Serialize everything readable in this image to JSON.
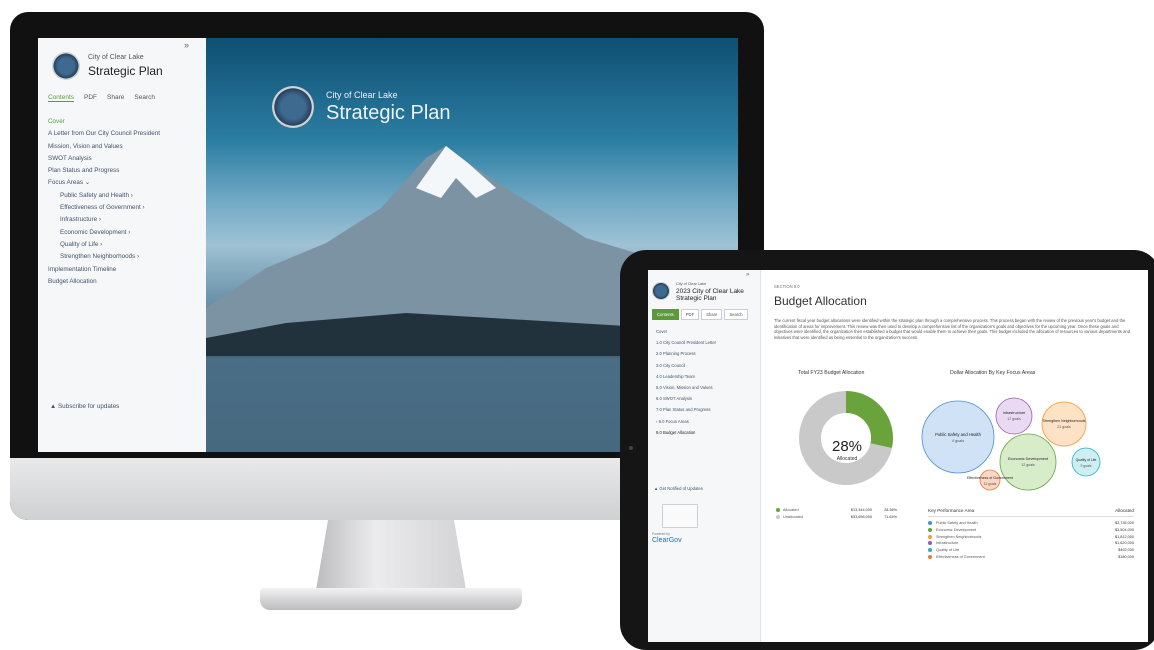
{
  "monitor": {
    "sidebar": {
      "city": "City of Clear Lake",
      "title": "Strategic Plan",
      "collapse_icon": "double-chevron-right-icon",
      "tabs": [
        "Contents",
        "PDF",
        "Share",
        "Search"
      ],
      "nav": [
        {
          "label": "Cover",
          "current": true
        },
        {
          "label": "A Letter from Our City Council President"
        },
        {
          "label": "Mission, Vision and Values"
        },
        {
          "label": "SWOT Analysis"
        },
        {
          "label": "Plan Status and Progress"
        },
        {
          "label": "Focus Areas"
        },
        {
          "label": "Public Safety and Health",
          "sub": true
        },
        {
          "label": "Effectiveness of Government",
          "sub": true
        },
        {
          "label": "Infrastructure",
          "sub": true
        },
        {
          "label": "Economic Development",
          "sub": true
        },
        {
          "label": "Quality of Life",
          "sub": true
        },
        {
          "label": "Strengthen Neighborhoods",
          "sub": true
        },
        {
          "label": "Implementation Timeline"
        },
        {
          "label": "Budget Allocation"
        }
      ],
      "subscribe": "Subscribe for updates"
    },
    "hero": {
      "city": "City of Clear Lake",
      "title": "Strategic Plan"
    }
  },
  "tablet": {
    "sidebar": {
      "city": "City of Clear Lake",
      "title": "2023 City of Clear Lake Strategic Plan",
      "tabs": [
        "Contents",
        "PDF",
        "Share",
        "Search"
      ],
      "nav": [
        "Cover",
        "1.0 City Council President Letter",
        "2.0 Planning Process",
        "3.0 City Council",
        "4.0 Leadership Team",
        "5.0 Vision, Mission and Values",
        "6.0 SWOT Analysis",
        "7.0 Plan Status and Progress",
        "8.0 Focus Areas",
        "9.0 Budget Allocation"
      ],
      "notify": "Get Notified of Updates",
      "powered_by": "Powered by",
      "brand": "ClearGov"
    },
    "main": {
      "section": "SECTION 9.0",
      "title": "Budget Allocation",
      "paragraph": "The current fiscal year budget allocations were identified within the strategic plan through a comprehensive process. This process began with the review of the previous year's budget and the identification of areas for improvement. This review was then used to develop a comprehensive list of the organization's goals and objectives for the upcoming year. Once these goals and objectives were identified, the organization then established a budget that would enable them to achieve their goals. This budget included the allocation of resources to various departments and initiatives that were identified as being essential to the organization's success.",
      "donut": {
        "title": "Total FY23 Budget Allocation",
        "percent": "28%",
        "sub": "Allocated",
        "legend": [
          {
            "label": "Allocated",
            "amount": "$13,344,000",
            "pct": "28.36%",
            "color": "#6aa33c"
          },
          {
            "label": "Unallocated",
            "amount": "$33,656,000",
            "pct": "71.64%",
            "color": "#c9c9c9"
          }
        ]
      },
      "bubbles": {
        "title": "Dollar Allocation By Key Focus Areas",
        "items": [
          {
            "name": "Public Safety and Health",
            "goals": "4 goals",
            "color": "#4a90d9"
          },
          {
            "name": "Infrastructure",
            "goals": "17 goals",
            "color": "#9b59b6"
          },
          {
            "name": "Strengthen Neighborhoods",
            "goals": "21 goals",
            "color": "#f39c3c"
          },
          {
            "name": "Economic Development",
            "goals": "12 goals",
            "color": "#6aa33c"
          },
          {
            "name": "Quality of Life",
            "goals": "9 goals",
            "color": "#2bb0c2"
          },
          {
            "name": "Effectiveness of Government",
            "goals": "11 goals",
            "color": "#e8793a"
          }
        ]
      },
      "table": {
        "header_area": "Key Performance Area",
        "header_alloc": "Allocated",
        "rows": [
          {
            "label": "Public Safety and Health",
            "value": "$3,736,000",
            "color": "#4a90d9"
          },
          {
            "label": "Economic Development",
            "value": "$3,504,000",
            "color": "#6aa33c"
          },
          {
            "label": "Strengthen Neighborhoods",
            "value": "$1,812,000",
            "color": "#f39c3c"
          },
          {
            "label": "Infrastructure",
            "value": "$1,620,000",
            "color": "#9b59b6"
          },
          {
            "label": "Quality of Life",
            "value": "$492,000",
            "color": "#2bb0c2"
          },
          {
            "label": "Effectiveness of Government",
            "value": "$180,000",
            "color": "#e8793a"
          }
        ]
      }
    }
  }
}
